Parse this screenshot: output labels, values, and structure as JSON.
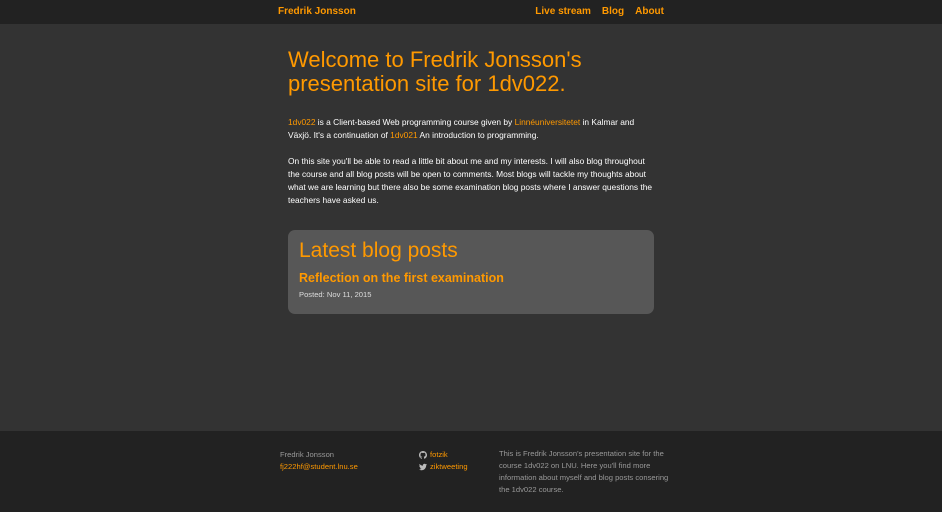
{
  "header": {
    "brand": "Fredrik Jonsson",
    "nav": [
      "Live stream",
      "Blog",
      "About"
    ]
  },
  "main": {
    "title": "Welcome to Fredrik Jonsson's presentation site for 1dv022.",
    "p1": {
      "link1": "1dv022",
      "text1": " is a Client-based Web programming course given by ",
      "link2": "Linnéuniversitetet",
      "text2": " in Kalmar and Växjö. It's a continuation of ",
      "link3": "1dv021",
      "text3": " An introduction to programming."
    },
    "p2": "On this site you'll be able to read a little bit about me and my interests. I will also blog throughout the course and all blog posts will be open to comments. Most blogs will tackle my thoughts about what we are learning but there also be some examination blog posts where I answer questions the teachers have asked us.",
    "latest": {
      "heading": "Latest blog posts",
      "post_title": "Reflection on the first examination",
      "post_date": "Posted: Nov 11, 2015"
    }
  },
  "footer": {
    "name": "Fredrik Jonsson",
    "email": "fj222hf@student.lnu.se",
    "github": "fotzik",
    "twitter": "ziktweeting",
    "about": "This is Fredrik Jonsson's presentation site for the course 1dv022 on LNU. Here you'll find more information about myself and blog posts consering the 1dv022 course."
  },
  "colors": {
    "accent": "#ff9900",
    "background": "#333333",
    "bars": "#222222",
    "card": "#575757"
  }
}
